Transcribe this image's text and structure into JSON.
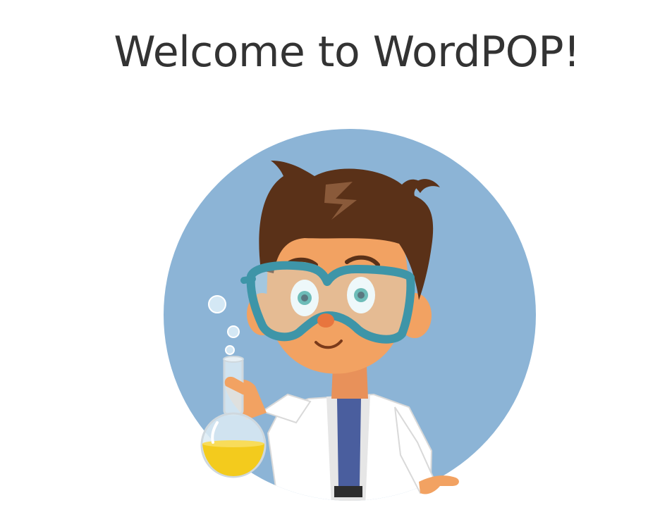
{
  "welcome": {
    "title": "Welcome to WordPOP!"
  },
  "illustration": {
    "name": "scientist-kid-illustration",
    "background_color": "#8CB4D6",
    "hair_color": "#5A3118",
    "skin_color": "#F2A262",
    "goggles_color": "#3E95A8",
    "coat_color": "#FFFFFF",
    "tie_color": "#4A5E9E",
    "liquid_color": "#F3CB1D"
  }
}
